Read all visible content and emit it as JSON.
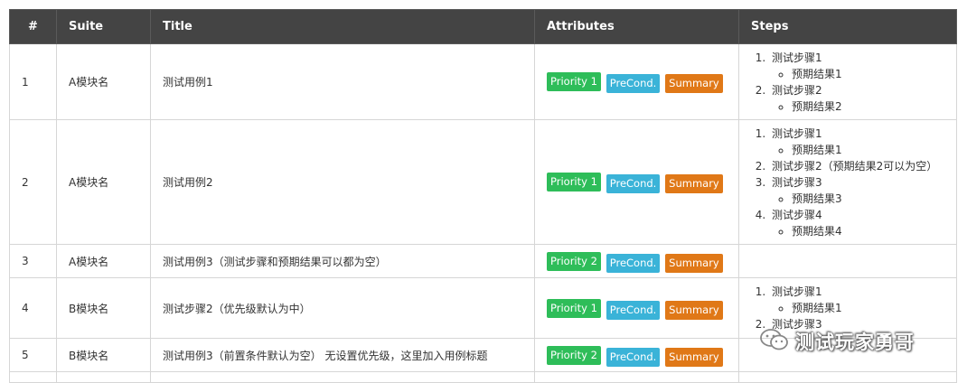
{
  "headers": {
    "num": "#",
    "suite": "Suite",
    "title": "Title",
    "attributes": "Attributes",
    "steps": "Steps"
  },
  "badges": {
    "preCond": "PreCond.",
    "summary": "Summary"
  },
  "rows": [
    {
      "num": "1",
      "suite": "A模块名",
      "title": "测试用例1",
      "priority": "Priority 1",
      "steps": [
        {
          "step": "测试步骤1",
          "results": [
            "预期结果1"
          ]
        },
        {
          "step": "测试步骤2",
          "results": [
            "预期结果2"
          ]
        }
      ]
    },
    {
      "num": "2",
      "suite": "A模块名",
      "title": "测试用例2",
      "priority": "Priority 1",
      "steps": [
        {
          "step": "测试步骤1",
          "results": [
            "预期结果1"
          ]
        },
        {
          "step": "测试步骤2（预期结果2可以为空）",
          "results": []
        },
        {
          "step": "测试步骤3",
          "results": [
            "预期结果3"
          ]
        },
        {
          "step": "测试步骤4",
          "results": [
            "预期结果4"
          ]
        }
      ]
    },
    {
      "num": "3",
      "suite": "A模块名",
      "title": "测试用例3（测试步骤和预期结果可以都为空）",
      "priority": "Priority 2",
      "steps": []
    },
    {
      "num": "4",
      "suite": "B模块名",
      "title": "测试步骤2（优先级默认为中）",
      "priority": "Priority 1",
      "steps": [
        {
          "step": "测试步骤1",
          "results": [
            "预期结果1"
          ]
        },
        {
          "step": "测试步骤3",
          "results": []
        }
      ]
    },
    {
      "num": "5",
      "suite": "B模块名",
      "title": "测试用例3（前置条件默认为空） 无设置优先级，这里加入用例标题",
      "priority": "Priority 2",
      "steps": []
    }
  ],
  "watermark": {
    "text": "测试玩家勇哥",
    "icon": "wechat-icon"
  },
  "colors": {
    "header_bg": "#444444",
    "priority": "#2ebd59",
    "precond": "#3ab3d8",
    "summary": "#e07817",
    "border": "#d6d6d6"
  }
}
